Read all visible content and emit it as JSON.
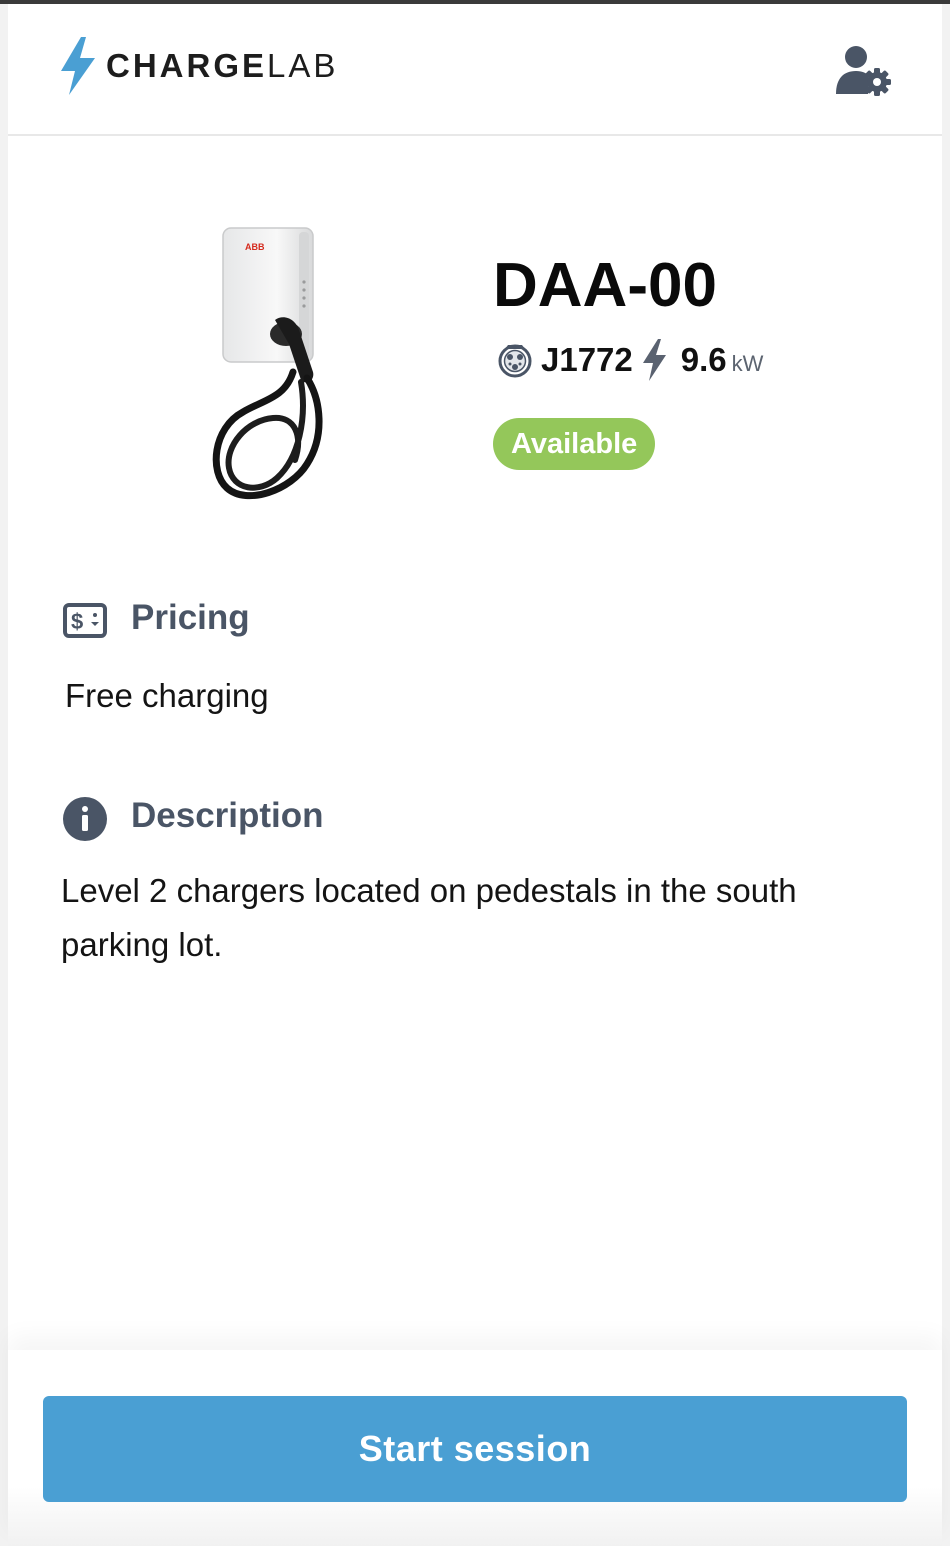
{
  "header": {
    "logo_charge": "CHARGE",
    "logo_lab": "LAB",
    "logo_color": "#4a9fd3",
    "user_settings_icon": "user-gear-icon"
  },
  "charger": {
    "name": "DAA-00",
    "image": "abb-wallbox-charger-image",
    "image_brand_text": "ABB",
    "connector_icon": "j1772-connector-icon",
    "connector_type": "J1772",
    "power_icon": "lightning-bolt-icon",
    "power_value": "9.6",
    "power_unit": "kW",
    "status": "Available",
    "status_color": "#94c75a"
  },
  "pricing": {
    "icon": "price-tag-icon",
    "title": "Pricing",
    "value": "Free charging"
  },
  "description": {
    "icon": "info-circle-icon",
    "title": "Description",
    "text": "Level 2 chargers located on pedestals in the south parking lot."
  },
  "footer": {
    "start_label": "Start session",
    "button_color": "#4a9fd3"
  }
}
